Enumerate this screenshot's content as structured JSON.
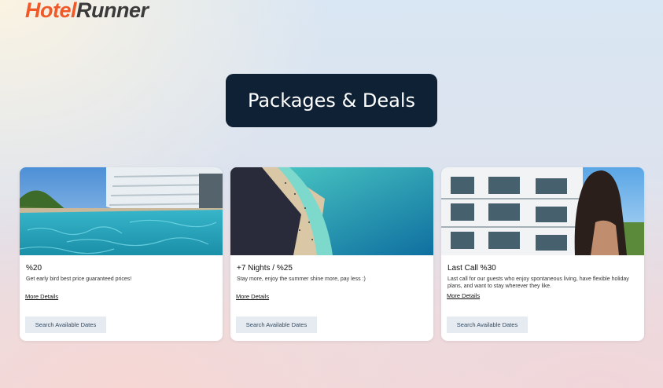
{
  "brand": {
    "part1": "Hotel",
    "part2": "Runner"
  },
  "header": {
    "title": "Packages & Deals"
  },
  "cards": [
    {
      "title": "%20",
      "description": "Get early bird best price guaranteed prices!",
      "more_label": "More Details",
      "button_label": "Search Available Dates"
    },
    {
      "title": "+7 Nights / %25",
      "description": "Stay more, enjoy the summer shine more, pay less :)",
      "more_label": "More Details",
      "button_label": "Search Available Dates"
    },
    {
      "title": "Last Call %30",
      "description": "Last call for our guests who enjoy spontaneous living, have flexible holiday plans, and want to stay wherever they like.",
      "more_label": "More Details",
      "button_label": "Search Available Dates"
    }
  ],
  "colors": {
    "brand_orange": "#f05a28",
    "title_bg": "#0f2235",
    "button_bg": "#e6ebf2"
  }
}
